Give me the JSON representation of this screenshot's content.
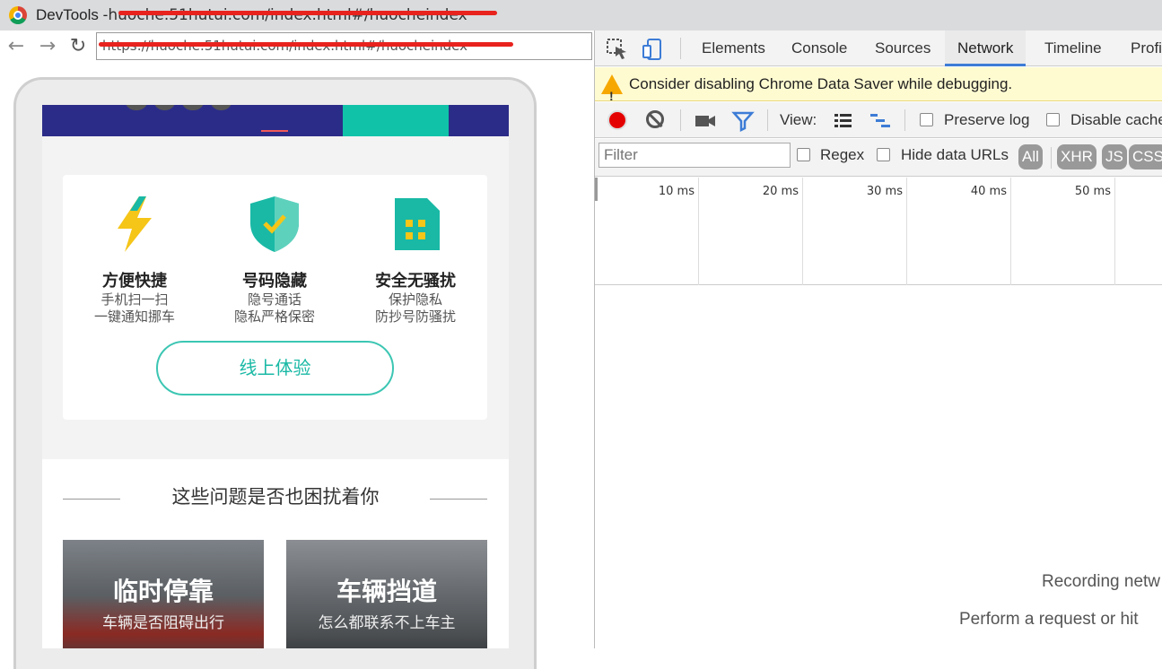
{
  "window": {
    "app_title": "DevTools - ",
    "title_url": "huoche.51hutui.com/index.html#/huocheindex"
  },
  "browser": {
    "url": "https://huoche.51hutui.com/index.html#/huocheindex"
  },
  "mobile_page": {
    "features": [
      {
        "title": "方便快捷",
        "line1": "手机扫一扫",
        "line2": "一键通知挪车",
        "icon": "lightning-icon"
      },
      {
        "title": "号码隐藏",
        "line1": "隐号通话",
        "line2": "隐私严格保密",
        "icon": "shield-check-icon"
      },
      {
        "title": "安全无骚扰",
        "line1": "保护隐私",
        "line2": "防抄号防骚扰",
        "icon": "sim-card-icon"
      }
    ],
    "try_button": "线上体验",
    "section_heading": "这些问题是否也困扰着你",
    "cards": [
      {
        "title": "临时停靠",
        "subtitle": "车辆是否阻碍出行"
      },
      {
        "title": "车辆挡道",
        "subtitle": "怎么都联系不上车主"
      }
    ]
  },
  "devtools": {
    "tabs": [
      "Elements",
      "Console",
      "Sources",
      "Network",
      "Timeline",
      "Profi"
    ],
    "active_tab": "Network",
    "warning": "Consider disabling Chrome Data Saver while debugging.",
    "toolbar": {
      "view_label": "View:",
      "preserve_log": "Preserve log",
      "disable_cache": "Disable cache"
    },
    "filter": {
      "placeholder": "Filter",
      "regex": "Regex",
      "hide_data_urls": "Hide data URLs",
      "types": [
        "All",
        "XHR",
        "JS",
        "CSS"
      ]
    },
    "timeline_ticks": [
      "10 ms",
      "20 ms",
      "30 ms",
      "40 ms",
      "50 ms"
    ],
    "empty_line1": "Recording netw",
    "empty_line2": "Perform a request or hit"
  },
  "colors": {
    "accent_teal": "#10c3a8",
    "banner_navy": "#2b2c88",
    "record_red": "#e50000",
    "tab_blue": "#3d7cd6"
  }
}
